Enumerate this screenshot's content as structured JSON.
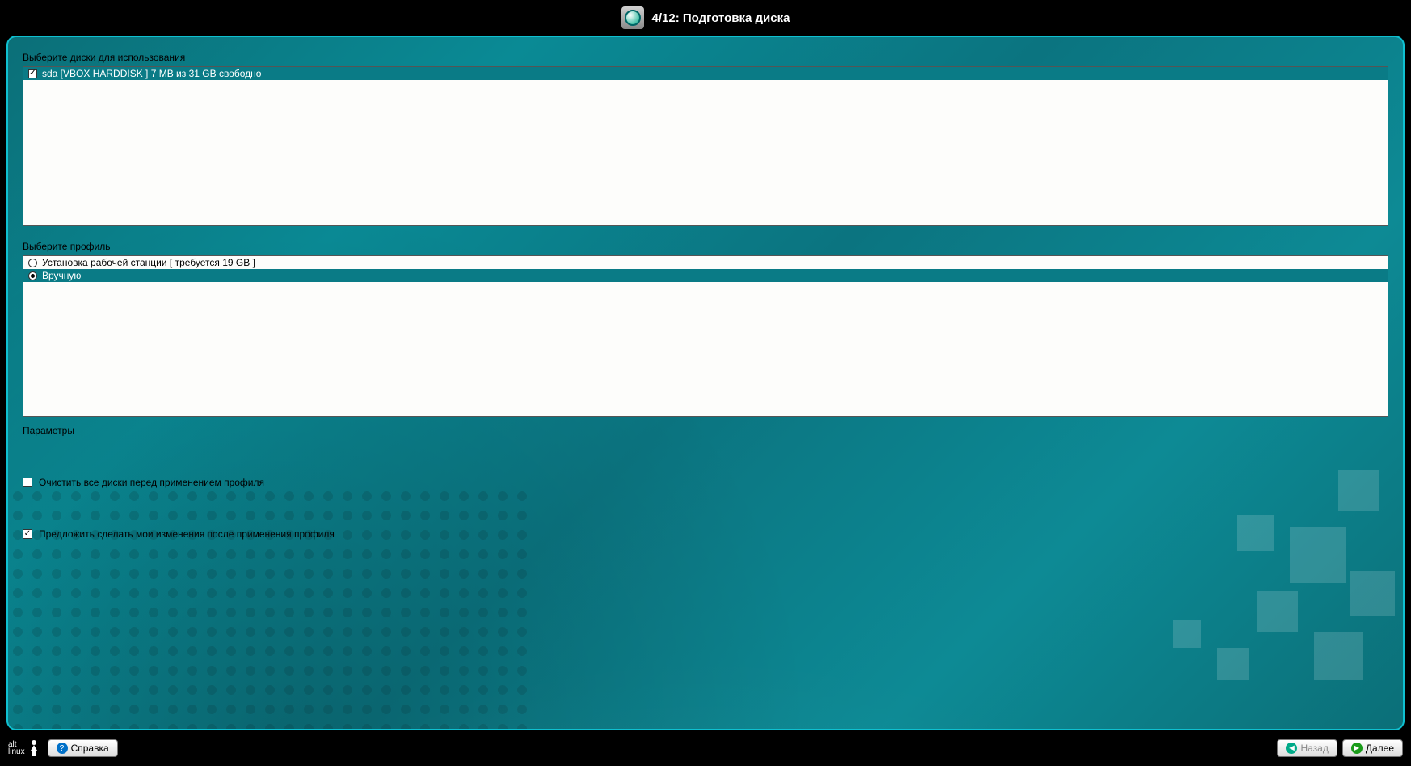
{
  "header": {
    "title": "4/12: Подготовка диска"
  },
  "sections": {
    "disks_label": "Выберите диски для использования",
    "profiles_label": "Выберите профиль",
    "params_label": "Параметры"
  },
  "disks": [
    {
      "checked": true,
      "label": "sda [VBOX HARDDISK   ]  7 MB из 31 GB свободно"
    }
  ],
  "profiles": [
    {
      "selected": false,
      "label": "Установка рабочей станции [ требуется 19 GB ]"
    },
    {
      "selected": true,
      "label": "Вручную"
    }
  ],
  "options": {
    "clear_disks": {
      "checked": false,
      "label": "Очистить все диски перед применением профиля"
    },
    "suggest_changes": {
      "checked": true,
      "label": "Предложить сделать мои изменения после применения профиля"
    }
  },
  "footer": {
    "logo_top": "alt",
    "logo_bottom": "linux",
    "help": "Справка",
    "back": "Назад",
    "next": "Далее"
  }
}
